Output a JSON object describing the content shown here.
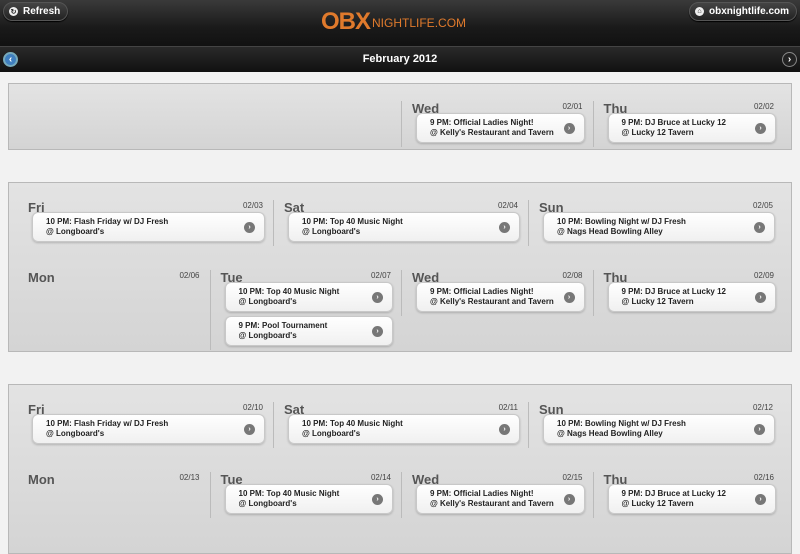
{
  "header": {
    "refresh_label": "Refresh",
    "logo_obx": "OBX",
    "logo_text": "NIGHTLIFE.COM",
    "site_label": "obxnightlife.com"
  },
  "nav": {
    "month_title": "February 2012"
  },
  "weeks": [
    {
      "rows": [
        [
          null,
          null,
          {
            "name": "Wed",
            "date": "02/01",
            "events": [
              {
                "title": "9 PM: Official Ladies Night!",
                "venue": "@ Kelly's Restaurant and Tavern"
              }
            ]
          },
          {
            "name": "Thu",
            "date": "02/02",
            "events": [
              {
                "title": "9 PM: DJ Bruce at Lucky 12",
                "venue": "@ Lucky 12 Tavern"
              }
            ]
          }
        ]
      ]
    },
    {
      "rows": [
        [
          {
            "name": "Fri",
            "date": "02/03",
            "events": [
              {
                "title": "10 PM: Flash Friday w/ DJ Fresh",
                "venue": "@ Longboard's"
              }
            ]
          },
          {
            "name": "Sat",
            "date": "02/04",
            "events": [
              {
                "title": "10 PM: Top 40 Music Night",
                "venue": "@ Longboard's"
              }
            ]
          },
          {
            "name": "Sun",
            "date": "02/05",
            "events": [
              {
                "title": "10 PM: Bowling Night w/ DJ Fresh",
                "venue": "@ Nags Head Bowling Alley"
              }
            ]
          }
        ],
        [
          {
            "name": "Mon",
            "date": "02/06",
            "events": []
          },
          {
            "name": "Tue",
            "date": "02/07",
            "events": [
              {
                "title": "10 PM: Top 40 Music Night",
                "venue": "@ Longboard's"
              },
              {
                "title": "9 PM: Pool Tournament",
                "venue": "@ Longboard's"
              }
            ]
          },
          {
            "name": "Wed",
            "date": "02/08",
            "events": [
              {
                "title": "9 PM: Official Ladies Night!",
                "venue": "@ Kelly's Restaurant and Tavern"
              }
            ]
          },
          {
            "name": "Thu",
            "date": "02/09",
            "events": [
              {
                "title": "9 PM: DJ Bruce at Lucky 12",
                "venue": "@ Lucky 12 Tavern"
              }
            ]
          }
        ]
      ]
    },
    {
      "rows": [
        [
          {
            "name": "Fri",
            "date": "02/10",
            "events": [
              {
                "title": "10 PM: Flash Friday w/ DJ Fresh",
                "venue": "@ Longboard's"
              }
            ]
          },
          {
            "name": "Sat",
            "date": "02/11",
            "events": [
              {
                "title": "10 PM: Top 40 Music Night",
                "venue": "@ Longboard's"
              }
            ]
          },
          {
            "name": "Sun",
            "date": "02/12",
            "events": [
              {
                "title": "10 PM: Bowling Night w/ DJ Fresh",
                "venue": "@ Nags Head Bowling Alley"
              }
            ]
          }
        ],
        [
          {
            "name": "Mon",
            "date": "02/13",
            "events": []
          },
          {
            "name": "Tue",
            "date": "02/14",
            "events": [
              {
                "title": "10 PM: Top 40 Music Night",
                "venue": "@ Longboard's"
              }
            ]
          },
          {
            "name": "Wed",
            "date": "02/15",
            "events": [
              {
                "title": "9 PM: Official Ladies Night!",
                "venue": "@ Kelly's Restaurant and Tavern"
              }
            ]
          },
          {
            "name": "Thu",
            "date": "02/16",
            "events": [
              {
                "title": "9 PM: DJ Bruce at Lucky 12",
                "venue": "@ Lucky 12 Tavern"
              }
            ]
          }
        ]
      ]
    }
  ]
}
